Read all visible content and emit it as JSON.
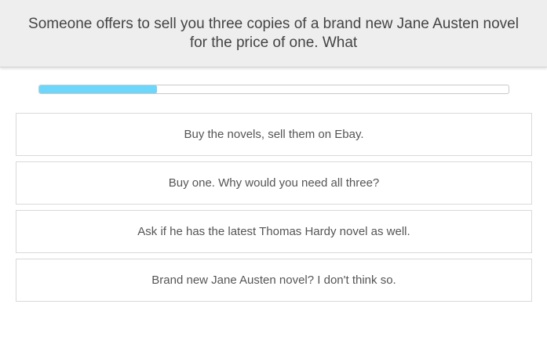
{
  "question": {
    "text": "Someone offers to sell you three copies of a brand new Jane Austen novel for the price of one. What"
  },
  "progress": {
    "fraction": 0.25,
    "color": "#6dd6fb"
  },
  "answers": [
    {
      "label": "Buy the novels, sell them on Ebay."
    },
    {
      "label": "Buy one. Why would you need all three?"
    },
    {
      "label": "Ask if he has the latest Thomas Hardy novel as well."
    },
    {
      "label": "Brand new Jane Austen novel? I don't think so."
    }
  ]
}
